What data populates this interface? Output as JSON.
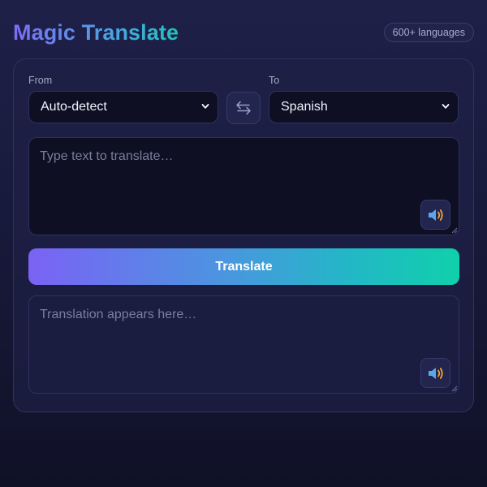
{
  "header": {
    "title": "Magic Translate",
    "badge": "600+ languages"
  },
  "from": {
    "label": "From",
    "selected": "Auto-detect"
  },
  "to": {
    "label": "To",
    "selected": "Spanish"
  },
  "source": {
    "placeholder": "Type text to translate…"
  },
  "action": {
    "label": "Translate"
  },
  "output": {
    "placeholder": "Translation appears here…"
  },
  "icons": {
    "swap": "swap-arrows-icon",
    "speak": "speaker-icon",
    "select_arrow": "chevron-down-icon"
  },
  "colors": {
    "accent_start": "#7b62f5",
    "accent_end": "#10d0ab"
  }
}
